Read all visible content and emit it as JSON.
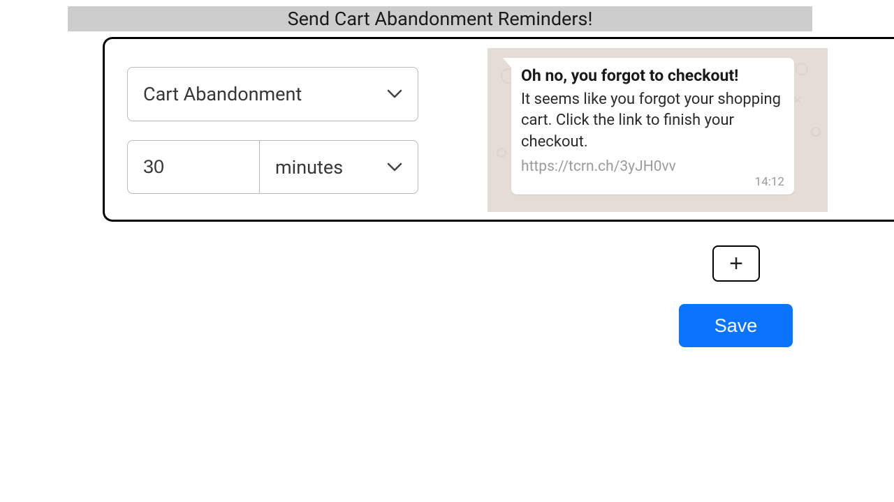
{
  "title": "Send Cart Abandonment Reminders!",
  "select": {
    "trigger": "Cart Abandonment"
  },
  "time": {
    "value": "30",
    "unit": "minutes"
  },
  "message": {
    "heading": "Oh no, you forgot to checkout!",
    "body": "It seems like you forgot your shopping cart. Click the link to finish your checkout.",
    "link": "https://tcrn.ch/3yJH0vv",
    "timestamp": "14:12"
  },
  "buttons": {
    "add": "+",
    "save": "Save"
  }
}
